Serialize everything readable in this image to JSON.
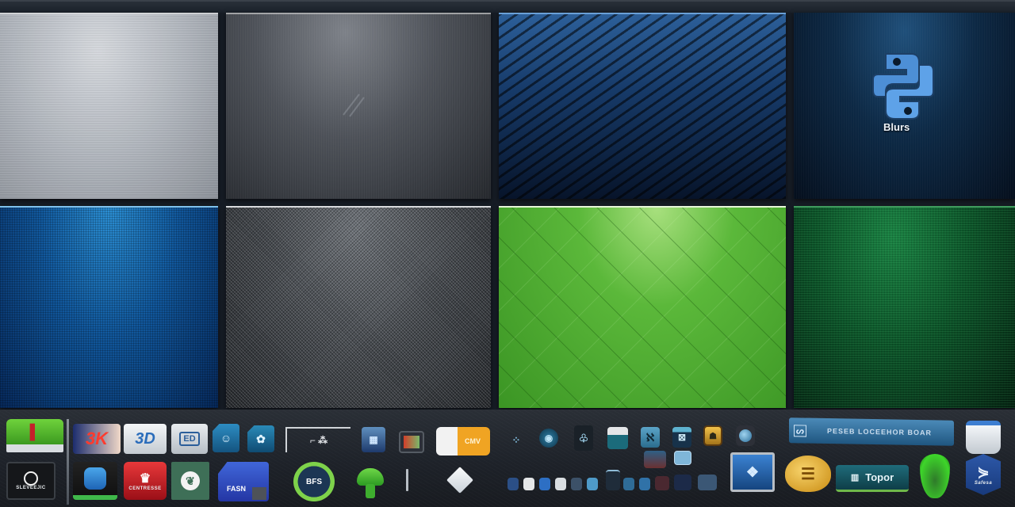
{
  "gallery": {
    "tiles": [
      {
        "id": "silver",
        "name": "brushed-silver-texture",
        "color": "#b6bbc2"
      },
      {
        "id": "graphite",
        "name": "graphite-texture",
        "color": "#4d5158"
      },
      {
        "id": "blue-stripe",
        "name": "blue-diagonal-stripe-texture",
        "color": "#173b6a"
      },
      {
        "id": "python",
        "name": "python-blurs-tile",
        "color": "#0d2945",
        "label": "Blurs"
      },
      {
        "id": "blue-mesh",
        "name": "blue-mesh-texture",
        "color": "#11589d"
      },
      {
        "id": "carbon",
        "name": "carbon-fiber-texture",
        "color": "#44484d"
      },
      {
        "id": "green-scale",
        "name": "green-scale-texture",
        "color": "#5bb83a"
      },
      {
        "id": "green-noise",
        "name": "green-noise-texture",
        "color": "#0d5a2c"
      }
    ]
  },
  "dock": {
    "row1": [
      {
        "name": "green-app-icon"
      },
      {
        "name": "3k-app-icon",
        "text": "3K"
      },
      {
        "name": "3d-app-icon",
        "text": "3D"
      },
      {
        "name": "monitor-app-icon",
        "text": "ED"
      },
      {
        "name": "blue-badge-icon-1"
      },
      {
        "name": "blue-badge-icon-2"
      },
      {
        "name": "frame-tool-icon"
      },
      {
        "name": "image-app-icon-1"
      },
      {
        "name": "photo-app-icon"
      },
      {
        "name": "bag-app-icon",
        "text": "CMV"
      },
      {
        "name": "small-icon-1"
      },
      {
        "name": "eye-app-icon"
      },
      {
        "name": "tree-app-icon"
      },
      {
        "name": "panel-app-icon"
      },
      {
        "name": "pattern-app-icon-1"
      },
      {
        "name": "pattern-app-icon-2"
      },
      {
        "name": "gold-app-icon"
      },
      {
        "name": "globe-app-icon"
      },
      {
        "name": "banner-app",
        "text": "PESEB LOCEEHOR  BOAR"
      },
      {
        "name": "printer-app-icon"
      }
    ],
    "row2": [
      {
        "name": "black-app-icon",
        "text": "SLEVEEJIC"
      },
      {
        "name": "blue-shield-app-icon"
      },
      {
        "name": "red-app-icon",
        "text": "CENTRESSE"
      },
      {
        "name": "green-leaf-app-icon"
      },
      {
        "name": "blue-dual-app-icon",
        "text": "FASN"
      },
      {
        "name": "green-ring-app-icon",
        "text": "BFS"
      },
      {
        "name": "green-mushroom-app-icon"
      },
      {
        "name": "separator-line"
      },
      {
        "name": "diamond-app-icon"
      },
      {
        "name": "mini-thumbnails-group"
      },
      {
        "name": "desktop-monitor-icon"
      },
      {
        "name": "gold-coil-icon"
      },
      {
        "name": "topor-app",
        "text": "Topor"
      },
      {
        "name": "green-drop-icon"
      },
      {
        "name": "blue-hexagon-icon",
        "text": "Safesa"
      }
    ]
  }
}
